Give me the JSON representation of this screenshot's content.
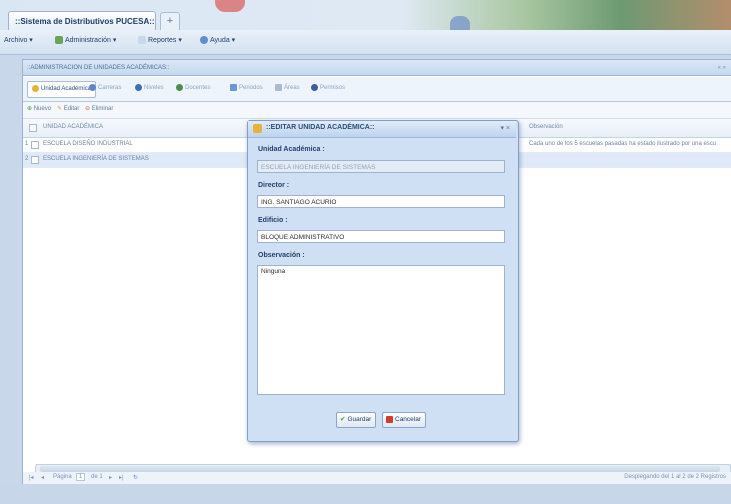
{
  "browser": {
    "tab_title": "::Sistema de Distributivos PUCESA::",
    "new_tab": "+"
  },
  "menu": {
    "items": [
      "Archivo",
      "Administración",
      "Reportes",
      "Ayuda"
    ]
  },
  "panel": {
    "title": "::ADMINISTRACION DE UNIDADES ACADÉMICAS::",
    "tabs": [
      "Unidad Académica",
      "Carreras",
      "Niveles",
      "Docentes",
      "Periodos",
      "Áreas",
      "Permisos"
    ],
    "toolbar": [
      "Nuevo",
      "Editar",
      "Eliminar"
    ],
    "grid": {
      "headers": [
        "UNIDAD ACADÉMICA",
        "Observación"
      ],
      "rows": [
        {
          "unidad": "ESCUELA DISEÑO INDUSTRIAL",
          "obs": "Cada uno de los 5 escuelas pasadas ha estado ilustrado por una escu"
        },
        {
          "unidad": "ESCUELA INGENIERÍA DE SISTEMAS",
          "obs": ""
        }
      ]
    },
    "pager": {
      "page_label": "Página",
      "page_value": "1",
      "of_label": "de 1",
      "summary": "Desplegando del 1 al 2 de 2 Registros"
    }
  },
  "modal": {
    "title": "::EDITAR UNIDAD ACADÉMICA::",
    "close": "×",
    "fields": {
      "unidad_label": "Unidad Académica :",
      "unidad_value": "ESCUELA INGENIERÍA DE SISTEMAS",
      "director_label": "Director :",
      "director_value": "ING. SANTIAGO ACURIO",
      "edificio_label": "Edificio :",
      "edificio_value": "BLOQUE ADMINISTRATIVO",
      "obs_label": "Observación :",
      "obs_value": "Ninguna"
    },
    "buttons": {
      "save": "Guardar",
      "cancel": "Cancelar"
    }
  },
  "colors": {
    "accent": "#2a4c7d",
    "window_bg": "#cfe0f4"
  }
}
